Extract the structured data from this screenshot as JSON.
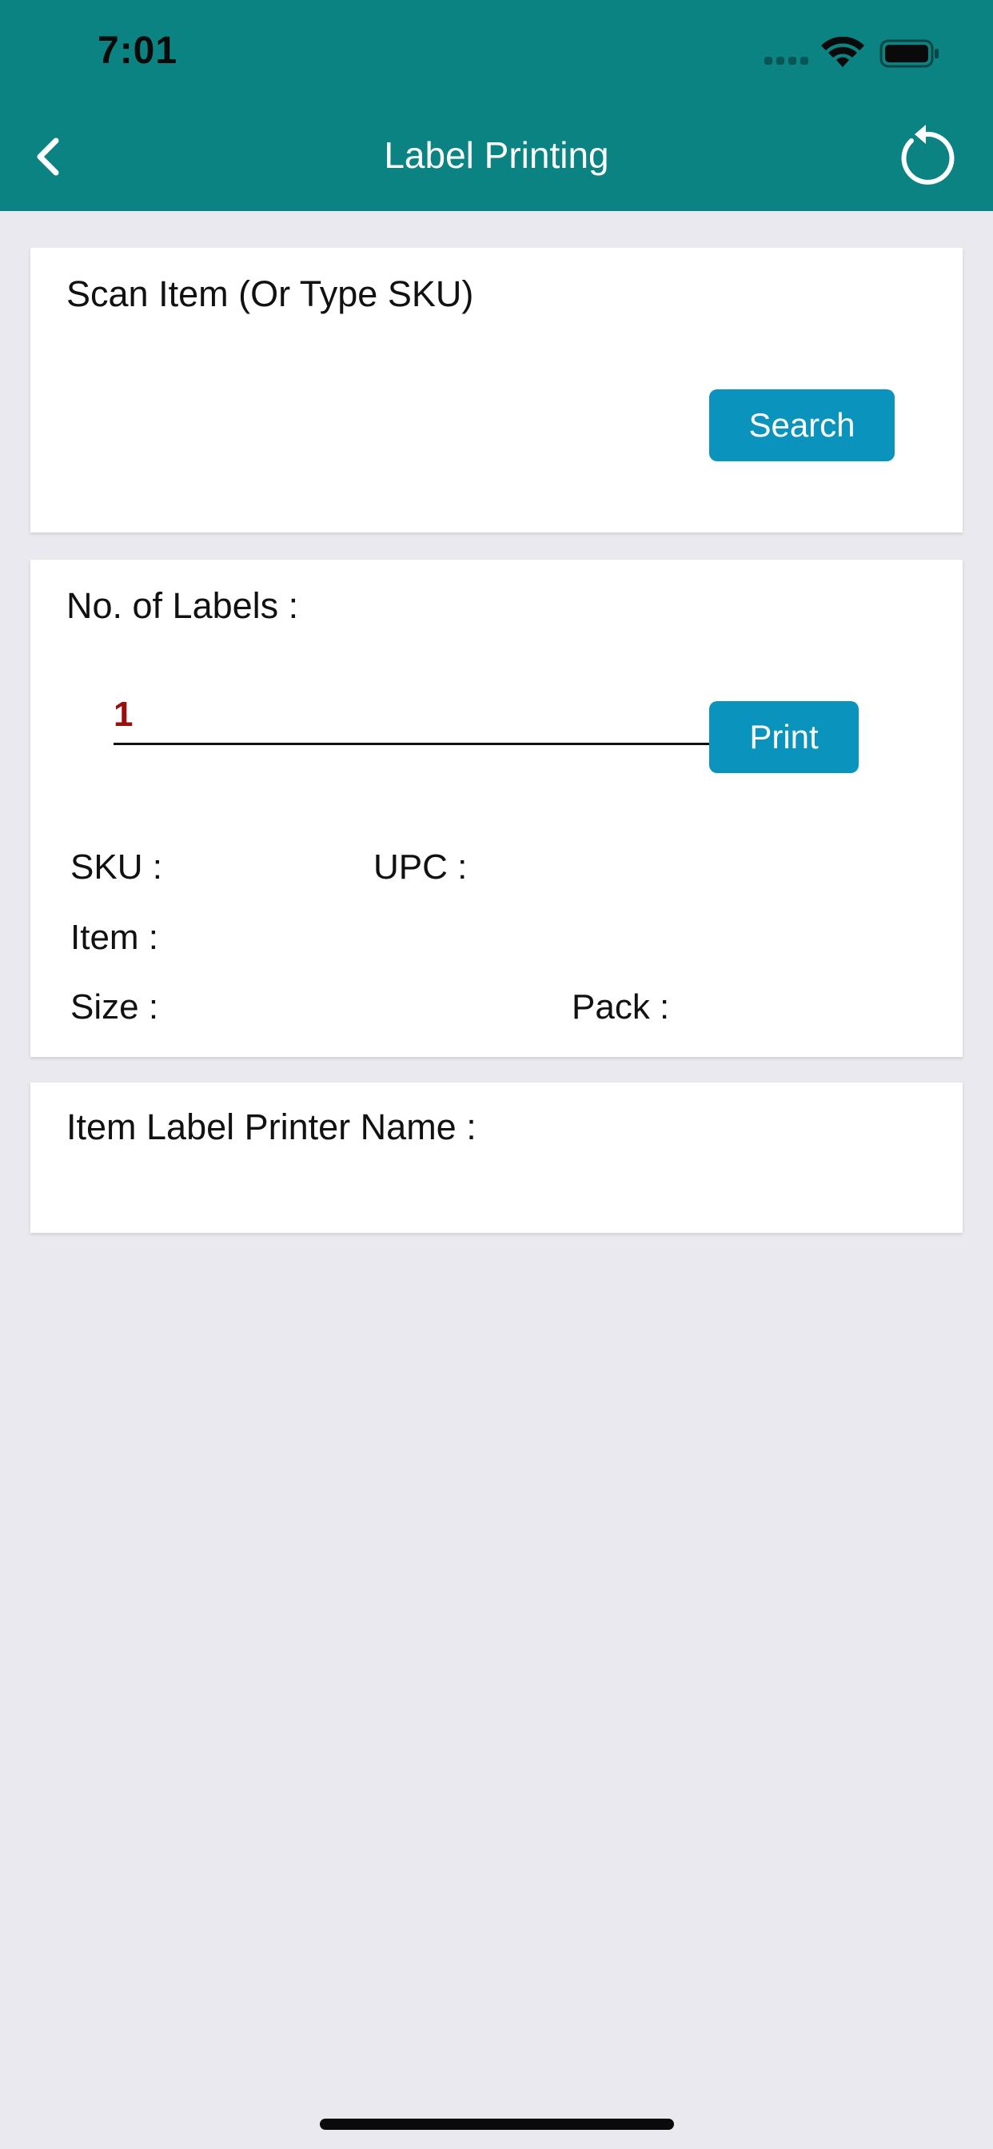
{
  "status_bar": {
    "time": "7:01"
  },
  "nav": {
    "title": "Label Printing",
    "back_icon": "chevron-left-icon",
    "refresh_icon": "refresh-icon"
  },
  "scan_card": {
    "label": "Scan Item (Or Type SKU)",
    "sku_value": "",
    "search_label": "Search"
  },
  "labels_card": {
    "label": "No. of Labels :",
    "count_value": "1",
    "print_label": "Print",
    "sku_label": "SKU :",
    "upc_label": "UPC :",
    "item_label": "Item :",
    "size_label": "Size :",
    "pack_label": "Pack :"
  },
  "printer_card": {
    "label": "Item Label Printer Name :"
  },
  "colors": {
    "header": "#0c8383",
    "button": "#0a94bd",
    "count_text": "#9b0e0e",
    "background": "#e9e9ef"
  }
}
